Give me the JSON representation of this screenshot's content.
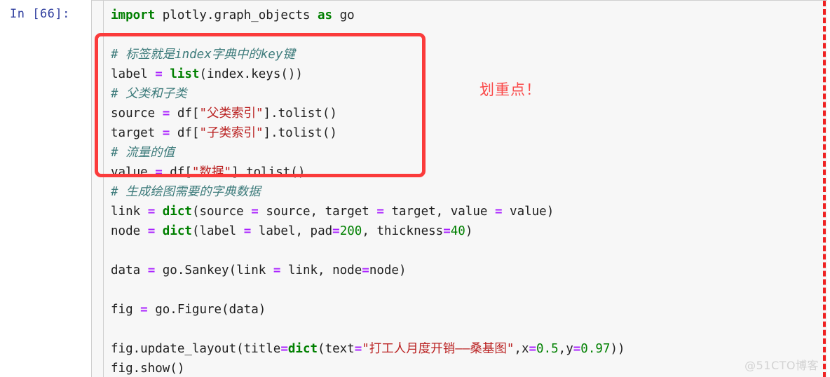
{
  "cell": {
    "prompt": "In [66]:",
    "prompt_color": "#303F9F",
    "background": "#f7f7f7",
    "border_color": "#cfcfcf"
  },
  "annotation": {
    "text": "划重点！",
    "color": "#fa4a4a"
  },
  "highlight_box": {
    "color": "#fb3b3b",
    "style": "solid-rounded-rectangle"
  },
  "edge_marker": {
    "color": "#ef2222",
    "style": "dashed-vertical-line"
  },
  "watermark": {
    "text": "@51CTO博客",
    "color": "#d2d2d2"
  },
  "syntax_colors": {
    "keyword": "#007F00",
    "builtin": "#008000",
    "operator": "#AA22FF",
    "string": "#BA2121",
    "number": "#008000",
    "comment": "#3D7B7B",
    "plain": "#202020"
  },
  "code": {
    "lines": [
      {
        "id": "l01",
        "text": "import plotly.graph_objects as go"
      },
      {
        "id": "l02",
        "text": ""
      },
      {
        "id": "l03",
        "text": "# 标签就是index字典中的key键"
      },
      {
        "id": "l04",
        "text": "label = list(index.keys())"
      },
      {
        "id": "l05",
        "text": "# 父类和子类"
      },
      {
        "id": "l06",
        "text": "source = df[\"父类索引\"].tolist()"
      },
      {
        "id": "l07",
        "text": "target = df[\"子类索引\"].tolist()"
      },
      {
        "id": "l08",
        "text": "# 流量的值"
      },
      {
        "id": "l09",
        "text": "value = df[\"数据\"].tolist()"
      },
      {
        "id": "l10",
        "text": "# 生成绘图需要的字典数据"
      },
      {
        "id": "l11",
        "text": "link = dict(source = source, target = target, value = value)"
      },
      {
        "id": "l12",
        "text": "node = dict(label = label, pad=200, thickness=40)"
      },
      {
        "id": "l13",
        "text": ""
      },
      {
        "id": "l14",
        "text": "data = go.Sankey(link = link, node=node)"
      },
      {
        "id": "l15",
        "text": ""
      },
      {
        "id": "l16",
        "text": "fig = go.Figure(data)"
      },
      {
        "id": "l17",
        "text": ""
      },
      {
        "id": "l18",
        "text": "fig.update_layout(title=dict(text=\"打工人月度开销——桑基图\",x=0.5,y=0.97))"
      },
      {
        "id": "l19",
        "text": "fig.show()"
      }
    ],
    "tokens": {
      "l01": [
        {
          "t": "import",
          "c": "kw"
        },
        {
          "t": " plotly.graph_objects ",
          "c": "pln"
        },
        {
          "t": "as",
          "c": "kw"
        },
        {
          "t": " go",
          "c": "pln"
        }
      ],
      "l03": [
        {
          "t": "# 标签就是index字典中的key键",
          "c": "cmt"
        }
      ],
      "l04": [
        {
          "t": "label ",
          "c": "pln"
        },
        {
          "t": "=",
          "c": "op"
        },
        {
          "t": " ",
          "c": "pln"
        },
        {
          "t": "list",
          "c": "bif"
        },
        {
          "t": "(index.keys())",
          "c": "pln"
        }
      ],
      "l05": [
        {
          "t": "# 父类和子类",
          "c": "cmt"
        }
      ],
      "l06": [
        {
          "t": "source ",
          "c": "pln"
        },
        {
          "t": "=",
          "c": "op"
        },
        {
          "t": " df[",
          "c": "pln"
        },
        {
          "t": "\"父类索引\"",
          "c": "str"
        },
        {
          "t": "].tolist()",
          "c": "pln"
        }
      ],
      "l07": [
        {
          "t": "target ",
          "c": "pln"
        },
        {
          "t": "=",
          "c": "op"
        },
        {
          "t": " df[",
          "c": "pln"
        },
        {
          "t": "\"子类索引\"",
          "c": "str"
        },
        {
          "t": "].tolist()",
          "c": "pln"
        }
      ],
      "l08": [
        {
          "t": "# 流量的值",
          "c": "cmt"
        }
      ],
      "l09": [
        {
          "t": "value ",
          "c": "pln"
        },
        {
          "t": "=",
          "c": "op"
        },
        {
          "t": " df[",
          "c": "pln"
        },
        {
          "t": "\"数据\"",
          "c": "str"
        },
        {
          "t": "].tolist()",
          "c": "pln"
        }
      ],
      "l10": [
        {
          "t": "# 生成绘图需要的字典数据",
          "c": "cmt"
        }
      ],
      "l11": [
        {
          "t": "link ",
          "c": "pln"
        },
        {
          "t": "=",
          "c": "op"
        },
        {
          "t": " ",
          "c": "pln"
        },
        {
          "t": "dict",
          "c": "bif"
        },
        {
          "t": "(source ",
          "c": "pln"
        },
        {
          "t": "=",
          "c": "op"
        },
        {
          "t": " source, target ",
          "c": "pln"
        },
        {
          "t": "=",
          "c": "op"
        },
        {
          "t": " target, value ",
          "c": "pln"
        },
        {
          "t": "=",
          "c": "op"
        },
        {
          "t": " value)",
          "c": "pln"
        }
      ],
      "l12": [
        {
          "t": "node ",
          "c": "pln"
        },
        {
          "t": "=",
          "c": "op"
        },
        {
          "t": " ",
          "c": "pln"
        },
        {
          "t": "dict",
          "c": "bif"
        },
        {
          "t": "(label ",
          "c": "pln"
        },
        {
          "t": "=",
          "c": "op"
        },
        {
          "t": " label, pad",
          "c": "pln"
        },
        {
          "t": "=",
          "c": "op"
        },
        {
          "t": "200",
          "c": "num"
        },
        {
          "t": ", thickness",
          "c": "pln"
        },
        {
          "t": "=",
          "c": "op"
        },
        {
          "t": "40",
          "c": "num"
        },
        {
          "t": ")",
          "c": "pln"
        }
      ],
      "l14": [
        {
          "t": "data ",
          "c": "pln"
        },
        {
          "t": "=",
          "c": "op"
        },
        {
          "t": " go.Sankey(link ",
          "c": "pln"
        },
        {
          "t": "=",
          "c": "op"
        },
        {
          "t": " link, node",
          "c": "pln"
        },
        {
          "t": "=",
          "c": "op"
        },
        {
          "t": "node)",
          "c": "pln"
        }
      ],
      "l16": [
        {
          "t": "fig ",
          "c": "pln"
        },
        {
          "t": "=",
          "c": "op"
        },
        {
          "t": " go.Figure(data)",
          "c": "pln"
        }
      ],
      "l18": [
        {
          "t": "fig.update_layout(title",
          "c": "pln"
        },
        {
          "t": "=",
          "c": "op"
        },
        {
          "t": "dict",
          "c": "bif"
        },
        {
          "t": "(text",
          "c": "pln"
        },
        {
          "t": "=",
          "c": "op"
        },
        {
          "t": "\"打工人月度开销——桑基图\"",
          "c": "str"
        },
        {
          "t": ",x",
          "c": "pln"
        },
        {
          "t": "=",
          "c": "op"
        },
        {
          "t": "0.5",
          "c": "num"
        },
        {
          "t": ",y",
          "c": "pln"
        },
        {
          "t": "=",
          "c": "op"
        },
        {
          "t": "0.97",
          "c": "num"
        },
        {
          "t": "))",
          "c": "pln"
        }
      ],
      "l19": [
        {
          "t": "fig.show()",
          "c": "pln"
        }
      ]
    }
  }
}
